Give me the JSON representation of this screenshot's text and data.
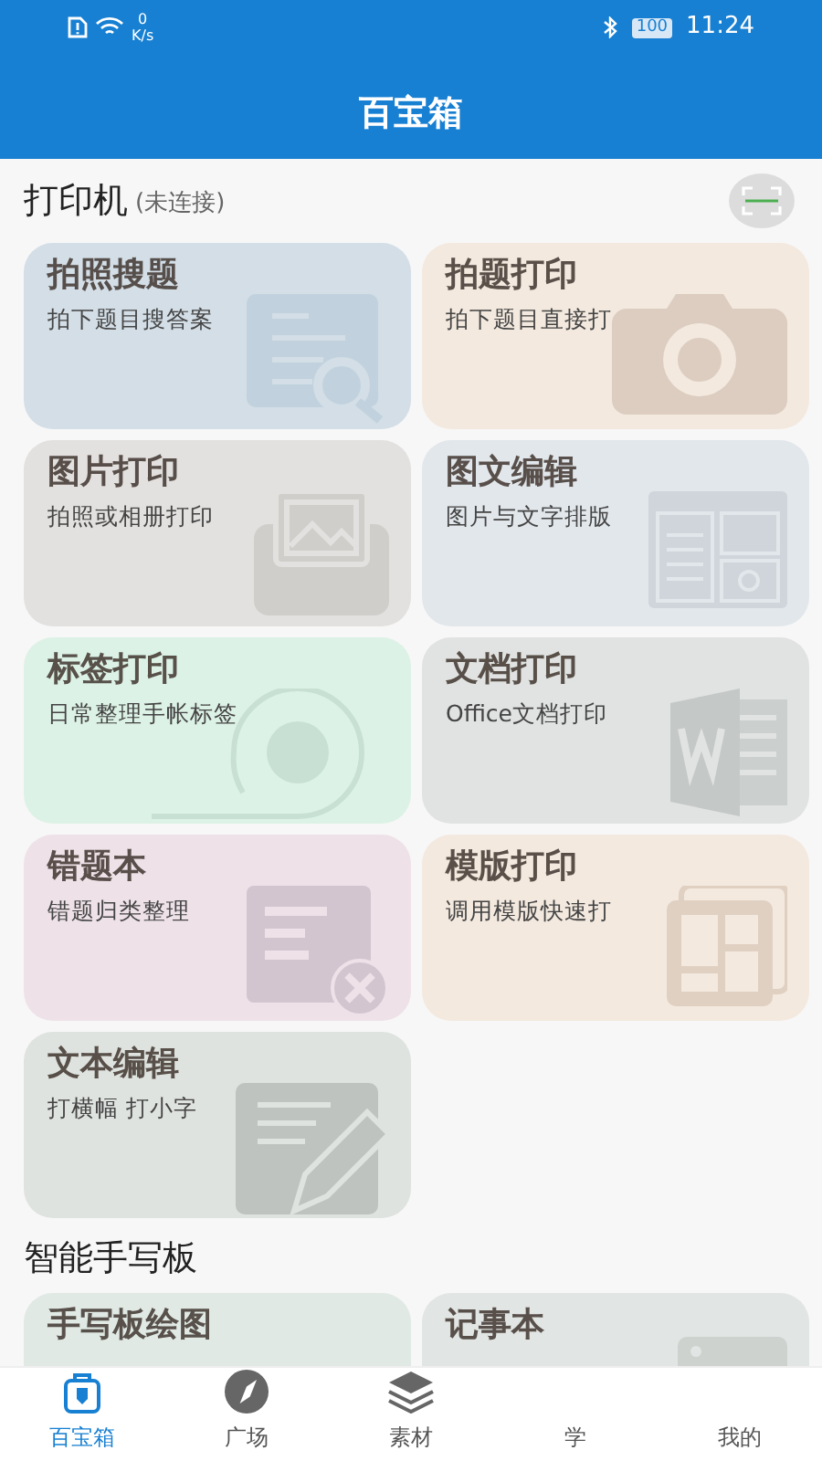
{
  "status_bar": {
    "speed_value": "0",
    "speed_unit": "K/s",
    "battery": "100",
    "time": "11:24"
  },
  "header": {
    "title": "百宝箱"
  },
  "sections": [
    {
      "title": "打印机",
      "note": "(未连接)",
      "scan_button": true,
      "cards": [
        {
          "title": "拍照搜题",
          "subtitle": "拍下题目搜答案",
          "color": "#d3dee6"
        },
        {
          "title": "拍题打印",
          "subtitle": "拍下题目直接打",
          "color": "#f3e9df"
        },
        {
          "title": "图片打印",
          "subtitle": "拍照或相册打印",
          "color": "#e3e1df"
        },
        {
          "title": "图文编辑",
          "subtitle": "图片与文字排版",
          "color": "#e2e7eb"
        },
        {
          "title": "标签打印",
          "subtitle": "日常整理手帐标签",
          "color": "#ddf2e6"
        },
        {
          "title": "文档打印",
          "subtitle": "Office文档打印",
          "color": "#e0e3e1"
        },
        {
          "title": "错题本",
          "subtitle": "错题归类整理",
          "color": "#eee2e8"
        },
        {
          "title": "模版打印",
          "subtitle": "调用模版快速打",
          "color": "#f3e9df"
        },
        {
          "title": "文本编辑",
          "subtitle": "打横幅 打小字",
          "color": "#dfe3df"
        }
      ]
    },
    {
      "title": "智能手写板",
      "cards": [
        {
          "title": "手写板绘图",
          "color": "#e0e9e4"
        },
        {
          "title": "记事本",
          "color": "#e1e5e3"
        }
      ]
    }
  ],
  "bottom_nav": [
    {
      "label": "百宝箱",
      "selected": true
    },
    {
      "label": "广场",
      "selected": false
    },
    {
      "label": "素材",
      "selected": false
    },
    {
      "label": "学",
      "selected": false
    },
    {
      "label": "我的",
      "selected": false
    }
  ]
}
